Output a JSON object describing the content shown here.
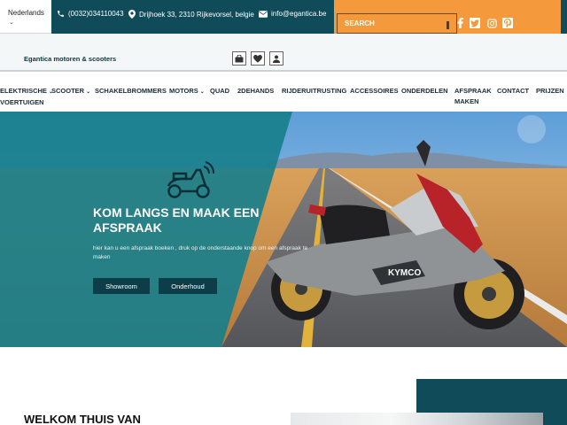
{
  "topbar": {
    "language": "Nederlands",
    "phone": "(0032)034110043",
    "address": "Drijhoek 33, 2310 Rijkevorsel, belgie",
    "email": "info@egantica.be",
    "search_placeholder": "SEARCH",
    "social_icons": [
      "facebook-icon",
      "twitter-icon",
      "instagram-icon",
      "pinterest-icon"
    ]
  },
  "header": {
    "brand": "Egantica motoren & scooters",
    "buttons": [
      "shop-icon",
      "heart-icon",
      "user-icon"
    ]
  },
  "nav": {
    "items": [
      {
        "label": "ELEKTRISCHE VOERTUIGEN",
        "line1": "ELEKTRISCHE",
        "line2": "VOERTUIGEN",
        "dropdown": true
      },
      {
        "label": "SCOOTER",
        "dropdown": true
      },
      {
        "label": "SCHAKELBROMMERS",
        "dropdown": false
      },
      {
        "label": "MOTORS",
        "dropdown": true
      },
      {
        "label": "QUAD",
        "dropdown": false
      },
      {
        "label": "2DEHANDS",
        "dropdown": false
      },
      {
        "label": "RIJDERUITRUSTING",
        "dropdown": false
      },
      {
        "label": "ACCESSOIRES",
        "dropdown": false
      },
      {
        "label": "ONDERDELEN",
        "dropdown": false
      },
      {
        "label": "AFSPRAAK MAKEN",
        "line1": "AFSPRAAK",
        "line2": "MAKEN",
        "dropdown": false
      },
      {
        "label": "CONTACT",
        "dropdown": false
      },
      {
        "label": "PRIJZEN",
        "dropdown": false
      }
    ]
  },
  "hero": {
    "title": "KOM LANGS EN MAAK EEN AFSPRAAK",
    "subtitle": "hier kan u een afspraak boeken , druk op de onderstaande knop om een afspraak te maken",
    "buttons": [
      "Showroom",
      "Onderhoud"
    ],
    "brand_on_scooter": "KYMCO"
  },
  "welcome": {
    "title": "WELKOM THUIS VAN"
  },
  "colors": {
    "primary": "#0f4b59",
    "accent": "#f49a3c",
    "button": "#0c3d48"
  }
}
